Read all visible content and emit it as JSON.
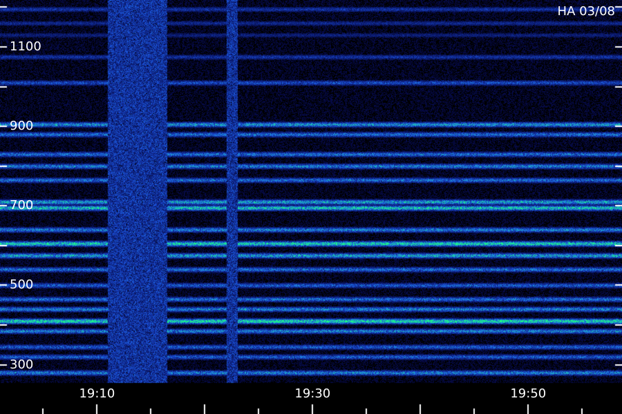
{
  "chart_data": {
    "type": "heatmap",
    "title": "HA 03/08",
    "xlabel": "",
    "ylabel": "",
    "x_ticks": [
      {
        "label": "19:10",
        "minutes": 10
      },
      {
        "label": "19:30",
        "minutes": 30
      },
      {
        "label": "19:50",
        "minutes": 50
      }
    ],
    "y_ticks": [
      {
        "label": "1100",
        "value": 1100
      },
      {
        "label": "900",
        "value": 900
      },
      {
        "label": "700",
        "value": 700
      },
      {
        "label": "500",
        "value": 500
      },
      {
        "label": "300",
        "value": 300
      }
    ],
    "xlim_minutes": [
      1,
      58.7
    ],
    "ylim": [
      254,
      1218
    ],
    "colors": {
      "background": "#000000",
      "axis": "#ffffff",
      "low": "#0a0a8c",
      "mid": "#1f5cff",
      "high": "#1aff80"
    },
    "bands": [
      {
        "y": 1195,
        "intensity": 0.35
      },
      {
        "y": 1160,
        "intensity": 0.3
      },
      {
        "y": 1130,
        "intensity": 0.25
      },
      {
        "y": 1075,
        "intensity": 0.35
      },
      {
        "y": 1010,
        "intensity": 0.45
      },
      {
        "y": 905,
        "intensity": 0.65
      },
      {
        "y": 880,
        "intensity": 0.55
      },
      {
        "y": 830,
        "intensity": 0.55
      },
      {
        "y": 800,
        "intensity": 0.6
      },
      {
        "y": 765,
        "intensity": 0.55
      },
      {
        "y": 710,
        "intensity": 0.7
      },
      {
        "y": 695,
        "intensity": 0.8
      },
      {
        "y": 640,
        "intensity": 0.6
      },
      {
        "y": 605,
        "intensity": 0.85
      },
      {
        "y": 575,
        "intensity": 0.7
      },
      {
        "y": 540,
        "intensity": 0.55
      },
      {
        "y": 500,
        "intensity": 0.5
      },
      {
        "y": 465,
        "intensity": 0.55
      },
      {
        "y": 440,
        "intensity": 0.6
      },
      {
        "y": 410,
        "intensity": 0.9
      },
      {
        "y": 385,
        "intensity": 0.6
      },
      {
        "y": 345,
        "intensity": 0.5
      },
      {
        "y": 320,
        "intensity": 0.5
      },
      {
        "y": 280,
        "intensity": 0.6
      }
    ],
    "noise_bursts_minutes": [
      [
        11,
        16.5
      ],
      [
        22,
        23
      ]
    ]
  }
}
